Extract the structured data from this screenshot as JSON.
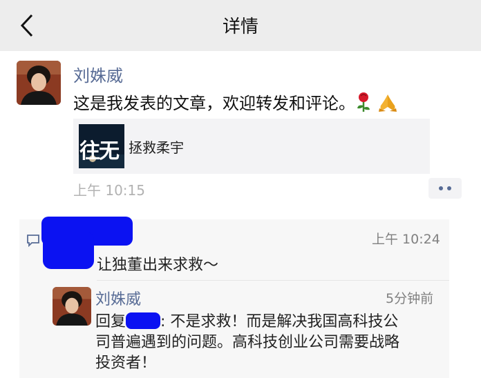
{
  "nav": {
    "title": "详情",
    "back_icon": "chevron-left-icon"
  },
  "post": {
    "author": "刘姝威",
    "text": "这是我发表的文章，欢迎转发和评论。",
    "emojis": [
      "rose-icon",
      "pray-icon"
    ],
    "link": {
      "thumb_text": "往无",
      "title": "拯救柔宇"
    },
    "time": "上午 10:15",
    "more_icon": "ellipsis-icon"
  },
  "comment": {
    "icon": "comment-icon",
    "text": "让独董出来求救～",
    "time": "上午 10:24"
  },
  "reply": {
    "author": "刘姝威",
    "time": "5分钟前",
    "prefix": "回复",
    "line1": ": 不是求救！而是解决我国高科技公",
    "line2": "司普遍遇到的问题。高科技创业公司需要战略",
    "line3": "投资者！"
  },
  "colors": {
    "link_blue": "#576b95",
    "redact_blue": "#0b12f2",
    "topbar": "#ededed"
  }
}
